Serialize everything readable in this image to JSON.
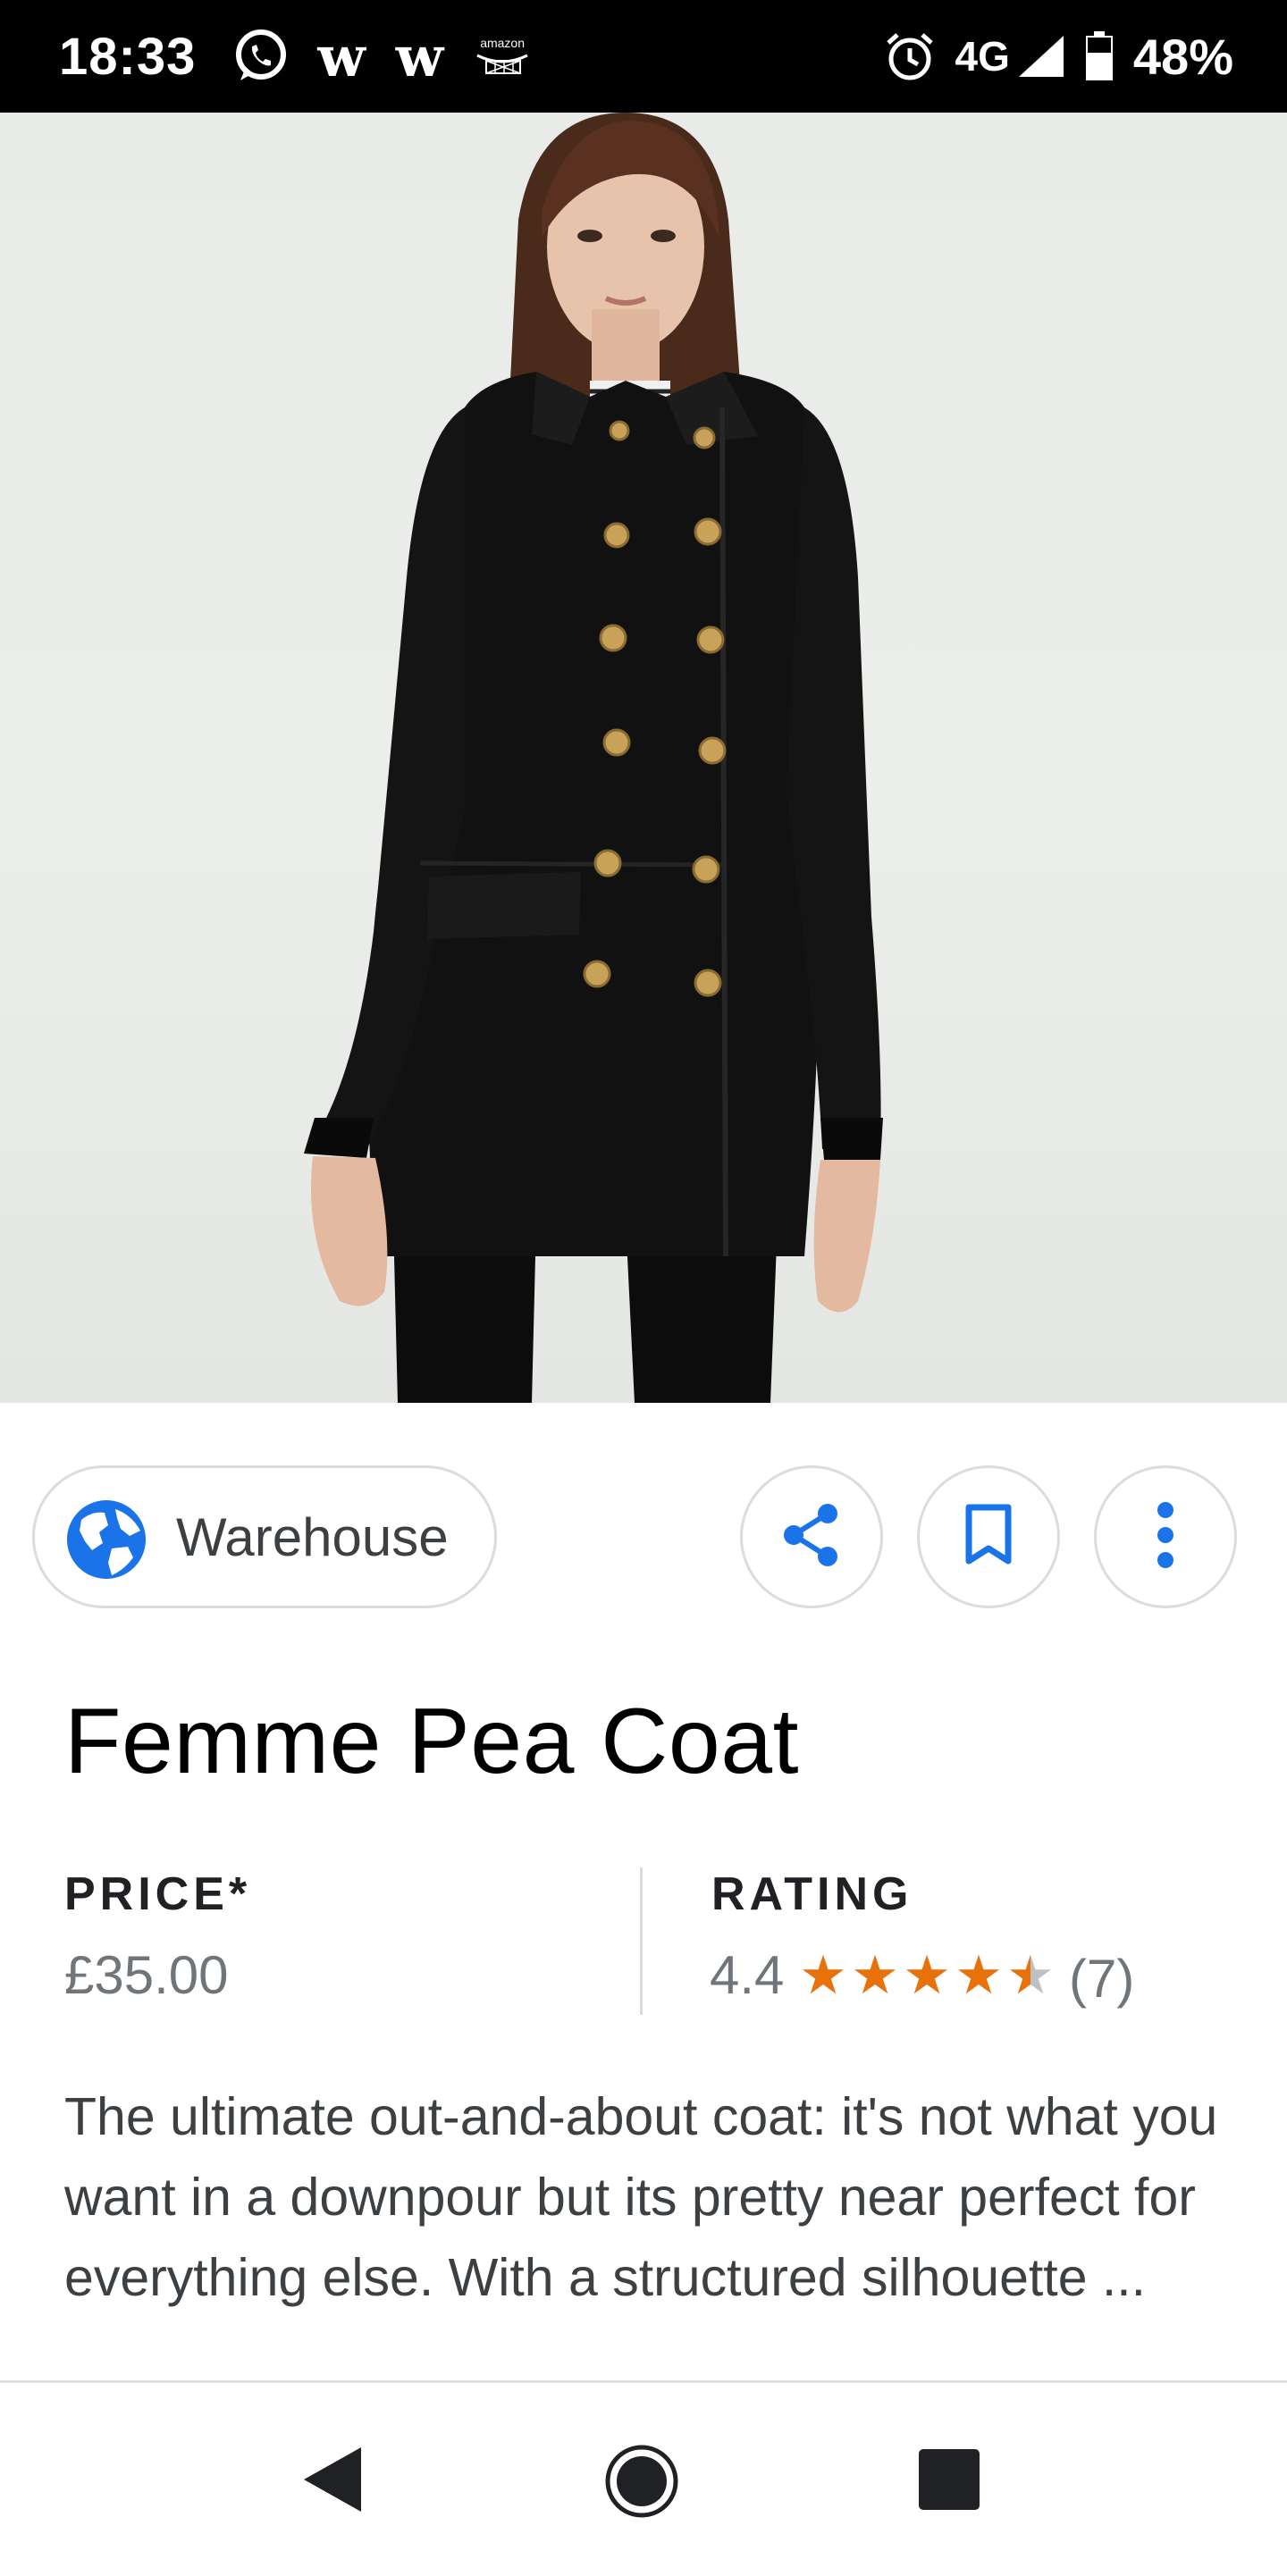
{
  "status_bar": {
    "time": "18:33",
    "notifications": [
      "whatsapp-icon",
      "w-app-icon",
      "w-app-icon",
      "amazon-icon"
    ],
    "w_glyph": "w",
    "amazon_text": "amazon",
    "network": "4G",
    "battery": "48%"
  },
  "product": {
    "source_label": "Warehouse",
    "title": "Femme Pea Coat",
    "price_label": "PRICE*",
    "price": "£35.00",
    "rating_label": "RATING",
    "rating_value": "4.4",
    "rating_stars": 4.4,
    "rating_count": "(7)",
    "description": "The ultimate out-and-about coat: it's not what you want in a downpour but its pretty near perfect for everything else. With a structured silhouette ..."
  },
  "actions": [
    "share-icon",
    "bookmark-icon",
    "more-vert-icon"
  ],
  "colors": {
    "star": "#e8710a",
    "accent": "#1a73e8",
    "coat": "#111111",
    "button": "#c9a25a"
  },
  "nav": [
    "back-icon",
    "home-icon",
    "recents-icon"
  ]
}
